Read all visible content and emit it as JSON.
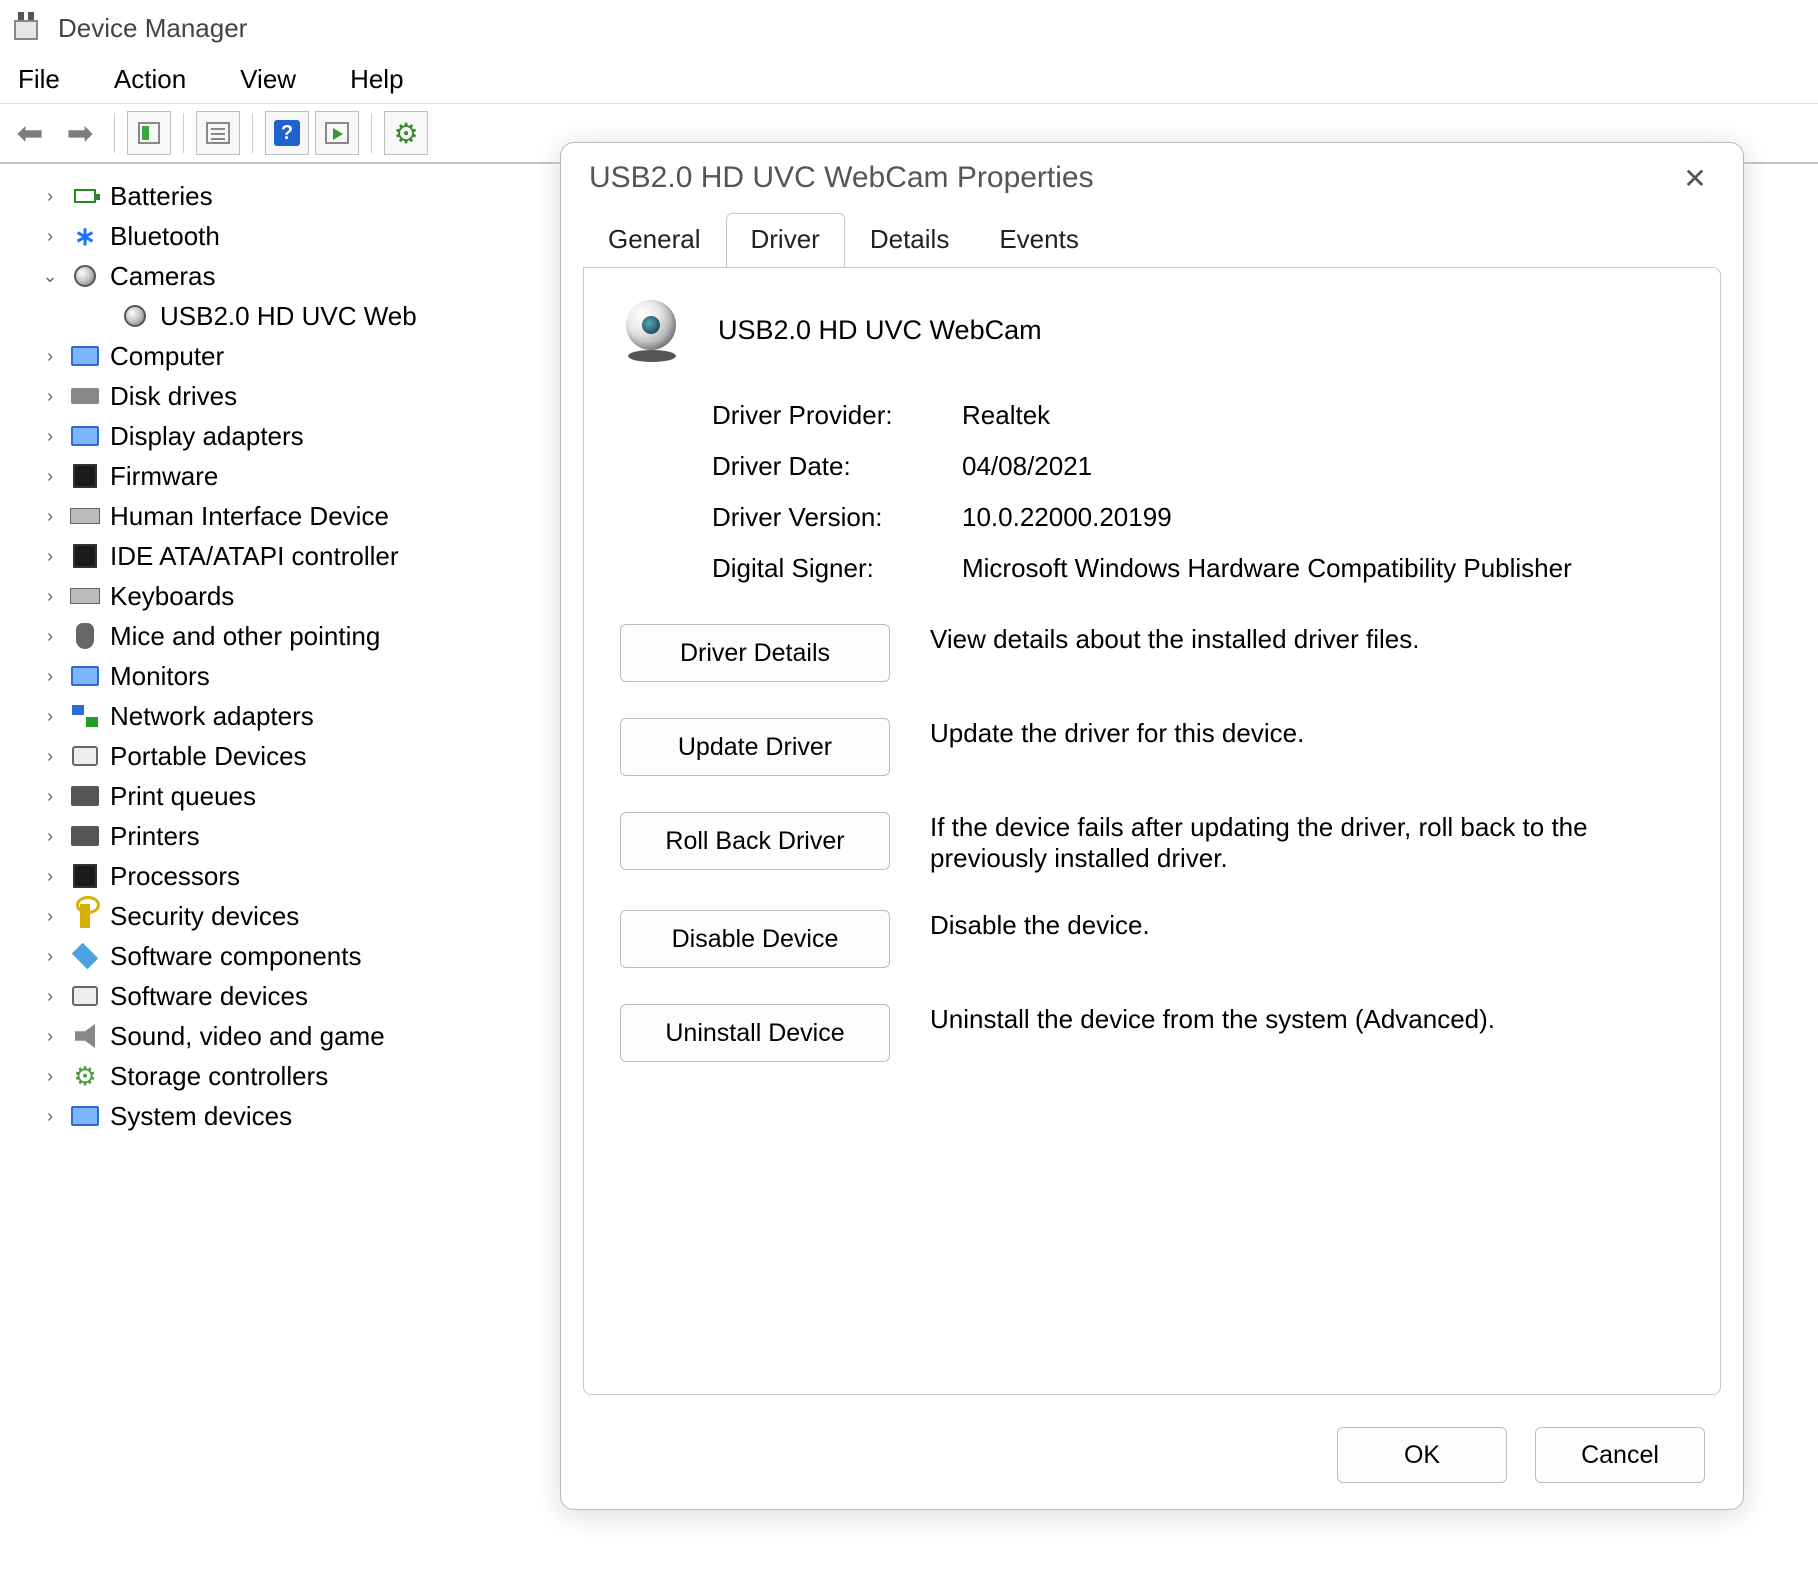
{
  "window": {
    "title": "Device Manager"
  },
  "menubar": {
    "file": "File",
    "action": "Action",
    "view": "View",
    "help": "Help"
  },
  "tree": {
    "items": [
      {
        "label": "Batteries",
        "icon": "battery",
        "chev": "›"
      },
      {
        "label": "Bluetooth",
        "icon": "bluetooth",
        "chev": "›"
      },
      {
        "label": "Cameras",
        "icon": "camera",
        "chev": "⌄",
        "expanded": true,
        "children": [
          {
            "label": "USB2.0 HD UVC Web",
            "icon": "camera"
          }
        ]
      },
      {
        "label": "Computer",
        "icon": "monitor",
        "chev": "›"
      },
      {
        "label": "Disk drives",
        "icon": "drive",
        "chev": "›"
      },
      {
        "label": "Display adapters",
        "icon": "monitor",
        "chev": "›"
      },
      {
        "label": "Firmware",
        "icon": "chip",
        "chev": "›"
      },
      {
        "label": "Human Interface Device",
        "icon": "kbd",
        "chev": "›"
      },
      {
        "label": "IDE ATA/ATAPI controller",
        "icon": "chip",
        "chev": "›"
      },
      {
        "label": "Keyboards",
        "icon": "kbd",
        "chev": "›"
      },
      {
        "label": "Mice and other pointing",
        "icon": "mouse",
        "chev": "›"
      },
      {
        "label": "Monitors",
        "icon": "monitor",
        "chev": "›"
      },
      {
        "label": "Network adapters",
        "icon": "net",
        "chev": "›"
      },
      {
        "label": "Portable Devices",
        "icon": "box",
        "chev": "›"
      },
      {
        "label": "Print queues",
        "icon": "printer",
        "chev": "›"
      },
      {
        "label": "Printers",
        "icon": "printer",
        "chev": "›"
      },
      {
        "label": "Processors",
        "icon": "chip",
        "chev": "›"
      },
      {
        "label": "Security devices",
        "icon": "key",
        "chev": "›"
      },
      {
        "label": "Software components",
        "icon": "cube",
        "chev": "›"
      },
      {
        "label": "Software devices",
        "icon": "box",
        "chev": "›"
      },
      {
        "label": "Sound, video and game",
        "icon": "speaker",
        "chev": "›"
      },
      {
        "label": "Storage controllers",
        "icon": "gear",
        "chev": "›"
      },
      {
        "label": "System devices",
        "icon": "monitor",
        "chev": "›"
      }
    ]
  },
  "dialog": {
    "title": "USB2.0 HD UVC WebCam Properties",
    "tabs": {
      "general": "General",
      "driver": "Driver",
      "details": "Details",
      "events": "Events"
    },
    "device_name": "USB2.0 HD UVC WebCam",
    "fields": {
      "provider_label": "Driver Provider:",
      "provider_value": "Realtek",
      "date_label": "Driver Date:",
      "date_value": "04/08/2021",
      "version_label": "Driver Version:",
      "version_value": "10.0.22000.20199",
      "signer_label": "Digital Signer:",
      "signer_value": "Microsoft Windows Hardware Compatibility Publisher"
    },
    "actions": {
      "details_btn": "Driver Details",
      "details_desc": "View details about the installed driver files.",
      "update_btn": "Update Driver",
      "update_desc": "Update the driver for this device.",
      "rollback_btn": "Roll Back Driver",
      "rollback_desc": "If the device fails after updating the driver, roll back to the previously installed driver.",
      "disable_btn": "Disable Device",
      "disable_desc": "Disable the device.",
      "uninstall_btn": "Uninstall Device",
      "uninstall_desc": "Uninstall the device from the system (Advanced)."
    },
    "ok": "OK",
    "cancel": "Cancel"
  }
}
